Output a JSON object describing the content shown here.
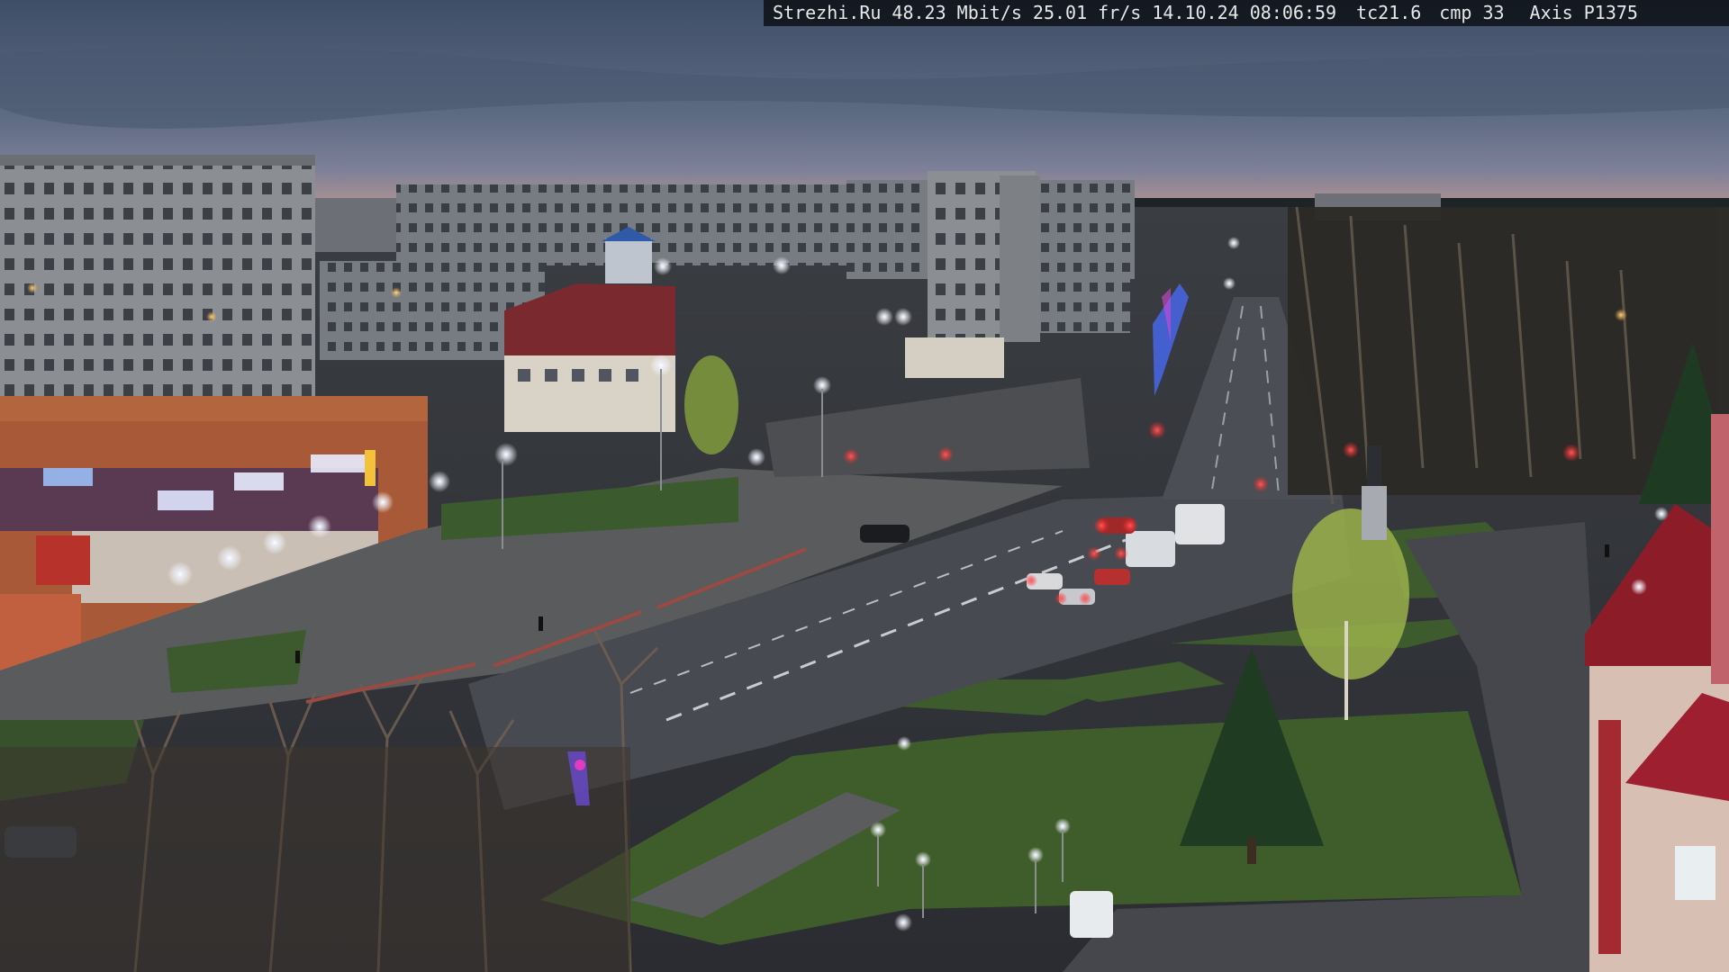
{
  "overlay": {
    "site": "Strezhi.Ru",
    "bitrate": "48.23 Mbit/s",
    "framerate": "25.01 fr/s",
    "timestamp": "14.10.24 08:06:59",
    "temp": "tc21.6",
    "cmp": "cmp 33",
    "camera": "Axis P1375"
  },
  "scene": {
    "store_sign_1": "",
    "store_sign_2": "",
    "store_sign_3": ""
  }
}
